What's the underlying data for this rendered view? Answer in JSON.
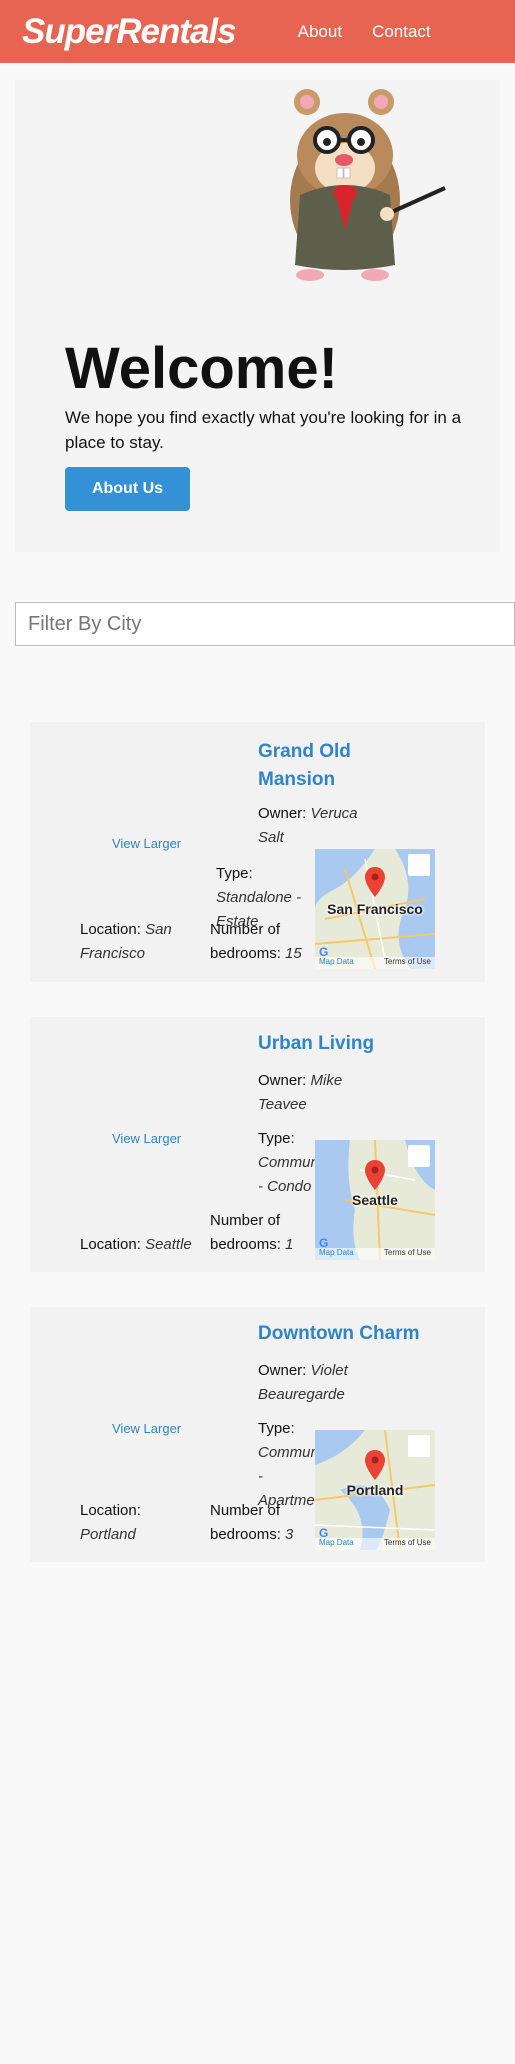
{
  "nav": {
    "brand": "SuperRentals",
    "links": [
      "About",
      "Contact"
    ]
  },
  "jumbo": {
    "heading": "Welcome!",
    "lead": "We hope you find exactly what you're looking for in a place to stay.",
    "button": "About Us"
  },
  "filter": {
    "placeholder": "Filter By City"
  },
  "listings": [
    {
      "title": "Grand Old Mansion",
      "owner_label": "Owner:",
      "owner": "Veruca Salt",
      "type_label": "Type:",
      "type": "Standalone - Estate",
      "location_label": "Location:",
      "location": "San Francisco",
      "bedrooms_label": "Number of bedrooms:",
      "bedrooms": "15",
      "view_larger": "View Larger",
      "map_city": "San Francisco",
      "map_data": "Map Data",
      "map_terms": "Terms of Use"
    },
    {
      "title": "Urban Living",
      "owner_label": "Owner:",
      "owner": "Mike Teavee",
      "type_label": "Type:",
      "type": "Community - Condo",
      "location_label": "Location:",
      "location": "Seattle",
      "bedrooms_label": "Number of bedrooms:",
      "bedrooms": "1",
      "view_larger": "View Larger",
      "map_city": "Seattle",
      "map_data": "Map Data",
      "map_terms": "Terms of Use"
    },
    {
      "title": "Downtown Charm",
      "owner_label": "Owner:",
      "owner": "Violet Beauregarde",
      "type_label": "Type:",
      "type": "Community - Apartment",
      "location_label": "Location:",
      "location": "Portland",
      "bedrooms_label": "Number of bedrooms:",
      "bedrooms": "3",
      "view_larger": "View Larger",
      "map_city": "Portland",
      "map_data": "Map Data",
      "map_terms": "Terms of Use"
    }
  ],
  "colors": {
    "nav": "#e86452",
    "primary": "#3491d6",
    "link": "#2f85c7"
  }
}
